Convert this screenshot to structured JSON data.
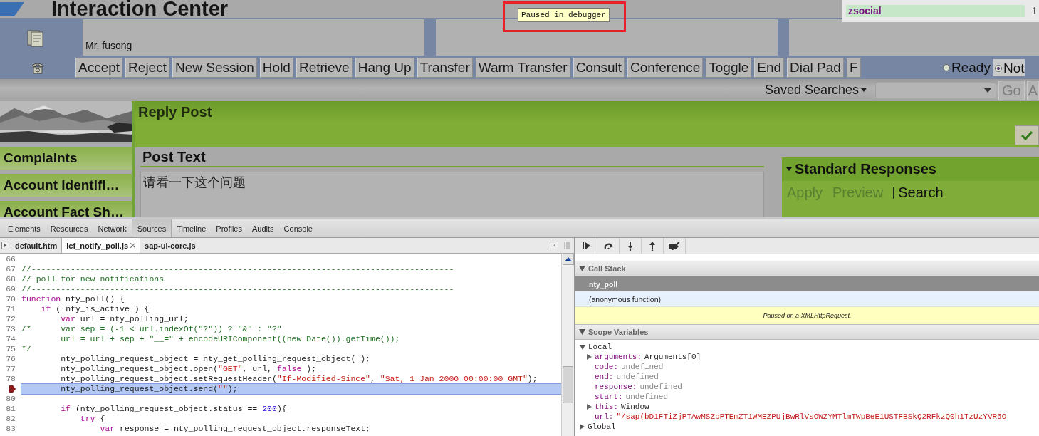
{
  "app": {
    "title": "Interaction Center",
    "debugger_tooltip": "Paused in debugger",
    "queue": {
      "name": "zsocial",
      "count": "1"
    },
    "customer": "Mr. fusong",
    "toolbar_buttons": [
      "Accept",
      "Reject",
      "New Session",
      "Hold",
      "Retrieve",
      "Hang Up",
      "Transfer",
      "Warm Transfer",
      "Consult",
      "Conference",
      "Toggle",
      "End",
      "Dial Pad",
      "F"
    ],
    "status_options": [
      {
        "label": "Ready",
        "selected": false
      },
      {
        "label": "Not",
        "selected": true
      }
    ],
    "saved_searches": {
      "label": "Saved Searches",
      "go_button": "Go",
      "next_button": "A"
    },
    "nav_items": [
      "Complaints",
      "Account Identifi…",
      "Account Fact Sh…"
    ],
    "reply_panel": {
      "title": "Reply Post",
      "post_text_label": "Post Text",
      "post_text": "请看一下这个问题"
    },
    "standard_responses": {
      "title": "Standard Responses",
      "actions": [
        {
          "label": "Apply",
          "disabled": true
        },
        {
          "label": "Preview",
          "disabled": true
        },
        {
          "label": "Search",
          "disabled": false
        }
      ]
    }
  },
  "devtools": {
    "tabs": [
      {
        "label": "Elements",
        "selected": false
      },
      {
        "label": "Resources",
        "selected": false
      },
      {
        "label": "Network",
        "selected": false
      },
      {
        "label": "Sources",
        "selected": true
      },
      {
        "label": "Timeline",
        "selected": false
      },
      {
        "label": "Profiles",
        "selected": false
      },
      {
        "label": "Audits",
        "selected": false
      },
      {
        "label": "Console",
        "selected": false
      }
    ],
    "files": [
      {
        "label": "default.htm",
        "selected": false,
        "closable": false
      },
      {
        "label": "icf_notify_poll.js",
        "selected": true,
        "closable": true
      },
      {
        "label": "sap-ui-core.js",
        "selected": false,
        "closable": false
      }
    ],
    "code_lines": [
      {
        "number": "66",
        "current": false
      },
      {
        "number": "67",
        "current": false,
        "segments": [
          {
            "text": "//--------------------------------------------------------------------------------------",
            "kind": "comment"
          }
        ]
      },
      {
        "number": "68",
        "current": false,
        "segments": [
          {
            "text": "// poll for new notifications",
            "kind": "comment"
          }
        ]
      },
      {
        "number": "69",
        "current": false,
        "segments": [
          {
            "text": "//--------------------------------------------------------------------------------------",
            "kind": "comment"
          }
        ]
      },
      {
        "number": "70",
        "current": false,
        "segments": [
          {
            "text": "function",
            "kind": "keyword"
          },
          {
            "text": " nty_poll() {",
            "kind": "plain"
          }
        ]
      },
      {
        "number": "71",
        "current": false,
        "segments": [
          {
            "text": "    if",
            "kind": "keyword"
          },
          {
            "text": " ( nty_is_active ) {",
            "kind": "plain"
          }
        ]
      },
      {
        "number": "72",
        "current": false,
        "segments": [
          {
            "text": "        var",
            "kind": "keyword"
          },
          {
            "text": " url = nty_polling_url;",
            "kind": "plain"
          }
        ]
      },
      {
        "number": "73",
        "current": false,
        "segments": [
          {
            "text": "/*      var sep = (-1 < url.indexOf(\"?\")) ? \"&\" : \"?\"",
            "kind": "comment"
          }
        ]
      },
      {
        "number": "74",
        "current": false,
        "segments": [
          {
            "text": "        url = url + sep + \"__=\" + encodeURIComponent((new Date()).getTime());",
            "kind": "comment"
          }
        ]
      },
      {
        "number": "75",
        "current": false,
        "segments": [
          {
            "text": "*/",
            "kind": "comment"
          }
        ]
      },
      {
        "number": "76",
        "current": false,
        "segments": [
          {
            "text": "        nty_polling_request_object = nty_get_polling_request_object( );",
            "kind": "plain"
          }
        ]
      },
      {
        "number": "77",
        "current": false,
        "segments": [
          {
            "text": "        nty_polling_request_object.open(",
            "kind": "plain"
          },
          {
            "text": "\"GET\"",
            "kind": "string"
          },
          {
            "text": ", url, ",
            "kind": "plain"
          },
          {
            "text": "false",
            "kind": "keyword"
          },
          {
            "text": " );",
            "kind": "plain"
          }
        ]
      },
      {
        "number": "78",
        "current": false,
        "segments": [
          {
            "text": "        nty_polling_request_object.setRequestHeader(",
            "kind": "plain"
          },
          {
            "text": "\"If-Modified-Since\"",
            "kind": "string"
          },
          {
            "text": ", ",
            "kind": "plain"
          },
          {
            "text": "\"Sat, 1 Jan 2000 00:00:00 GMT\"",
            "kind": "string"
          },
          {
            "text": ");",
            "kind": "plain"
          }
        ]
      },
      {
        "current": true,
        "segments": [
          {
            "text": "        nty_polling_request_object.send(",
            "kind": "plain"
          },
          {
            "text": "\"\"",
            "kind": "string"
          },
          {
            "text": ");",
            "kind": "plain"
          }
        ]
      },
      {
        "number": "80",
        "current": false
      },
      {
        "number": "81",
        "current": false,
        "segments": [
          {
            "text": "        if",
            "kind": "keyword"
          },
          {
            "text": " (nty_polling_request_object.status == ",
            "kind": "plain"
          },
          {
            "text": "200",
            "kind": "number"
          },
          {
            "text": "){",
            "kind": "plain"
          }
        ]
      },
      {
        "number": "82",
        "current": false,
        "segments": [
          {
            "text": "            try",
            "kind": "keyword"
          },
          {
            "text": " {",
            "kind": "plain"
          }
        ]
      },
      {
        "number": "83",
        "current": false,
        "segments": [
          {
            "text": "                var",
            "kind": "keyword"
          },
          {
            "text": " response = nty_polling_request_object.responseText;",
            "kind": "plain"
          }
        ]
      }
    ],
    "call_stack": {
      "title": "Call Stack",
      "frames": [
        {
          "label": "nty_poll",
          "selected": true
        },
        {
          "label": "(anonymous function)",
          "selected": false
        }
      ]
    },
    "pause_message": "Paused on a XMLHttpRequest.",
    "scope": {
      "title": "Scope Variables",
      "groups": [
        {
          "label": "Local",
          "expanded": true,
          "variables": [
            {
              "name": "arguments:",
              "value": "Arguments[0]",
              "expandable": true,
              "kind": "object"
            },
            {
              "name": "code:",
              "value": "undefined",
              "expandable": false,
              "kind": "undefined"
            },
            {
              "name": "end:",
              "value": "undefined",
              "expandable": false,
              "kind": "undefined"
            },
            {
              "name": "response:",
              "value": "undefined",
              "expandable": false,
              "kind": "undefined"
            },
            {
              "name": "start:",
              "value": "undefined",
              "expandable": false,
              "kind": "undefined"
            },
            {
              "name": "this:",
              "value": "Window",
              "expandable": true,
              "kind": "object"
            },
            {
              "name": "url:",
              "value": "\"/sap(bD1FTiZjPTAwMSZpPTEmZT1WMEZPUjBwRlVsOWZYMTlmTWpBeE1USTFBSkQ2RFkzQ0h1TzUzYVR6O",
              "expandable": false,
              "kind": "string"
            }
          ]
        },
        {
          "label": "Global",
          "expanded": false
        }
      ]
    }
  }
}
